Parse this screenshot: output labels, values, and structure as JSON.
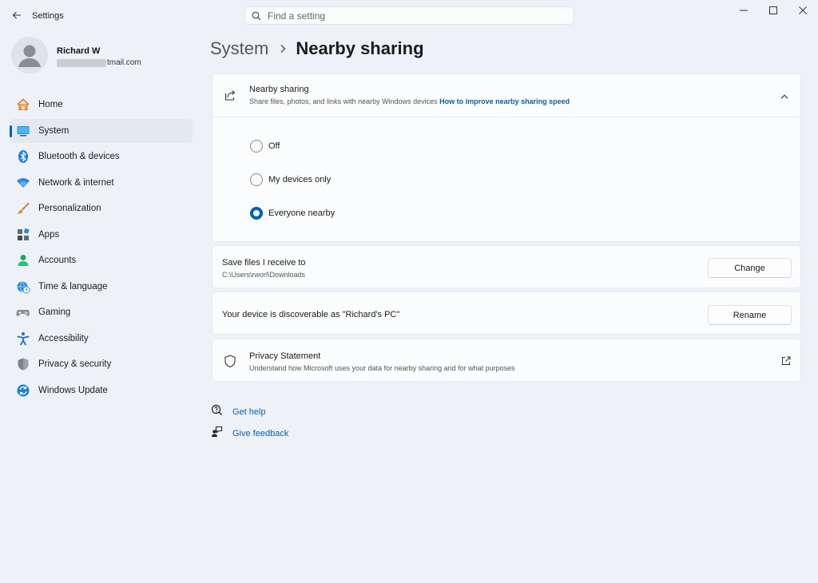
{
  "window": {
    "title": "Settings",
    "search_placeholder": "Find a setting"
  },
  "profile": {
    "name": "Richard W",
    "email_visible": "tmail.com"
  },
  "sidebar": {
    "items": [
      {
        "label": "Home",
        "icon": "home-icon"
      },
      {
        "label": "System",
        "icon": "system-icon",
        "active": true
      },
      {
        "label": "Bluetooth & devices",
        "icon": "bluetooth-icon"
      },
      {
        "label": "Network & internet",
        "icon": "wifi-icon"
      },
      {
        "label": "Personalization",
        "icon": "brush-icon"
      },
      {
        "label": "Apps",
        "icon": "apps-icon"
      },
      {
        "label": "Accounts",
        "icon": "accounts-icon"
      },
      {
        "label": "Time & language",
        "icon": "globe-clock-icon"
      },
      {
        "label": "Gaming",
        "icon": "gamepad-icon"
      },
      {
        "label": "Accessibility",
        "icon": "accessibility-icon"
      },
      {
        "label": "Privacy & security",
        "icon": "shield-icon"
      },
      {
        "label": "Windows Update",
        "icon": "update-icon"
      }
    ]
  },
  "breadcrumb": {
    "parent": "System",
    "current": "Nearby sharing"
  },
  "nearby_sharing": {
    "title": "Nearby sharing",
    "description": "Share files, photos, and links with nearby Windows devices",
    "link": "How to improve nearby sharing speed",
    "options": [
      {
        "label": "Off",
        "checked": false
      },
      {
        "label": "My devices only",
        "checked": false
      },
      {
        "label": "Everyone nearby",
        "checked": true
      }
    ]
  },
  "save_files": {
    "title": "Save files I receive to",
    "path": "C:\\Users\\rworl\\Downloads",
    "button": "Change"
  },
  "discoverable": {
    "title": "Your device is discoverable as \"Richard's PC\"",
    "button": "Rename"
  },
  "privacy": {
    "title": "Privacy Statement",
    "description": "Understand how Microsoft uses your data for nearby sharing and for what purposes"
  },
  "help": {
    "get_help": "Get help",
    "give_feedback": "Give feedback"
  },
  "colors": {
    "accent": "#005fb8",
    "link": "#0b5ea8",
    "background": "#eef2f8"
  }
}
